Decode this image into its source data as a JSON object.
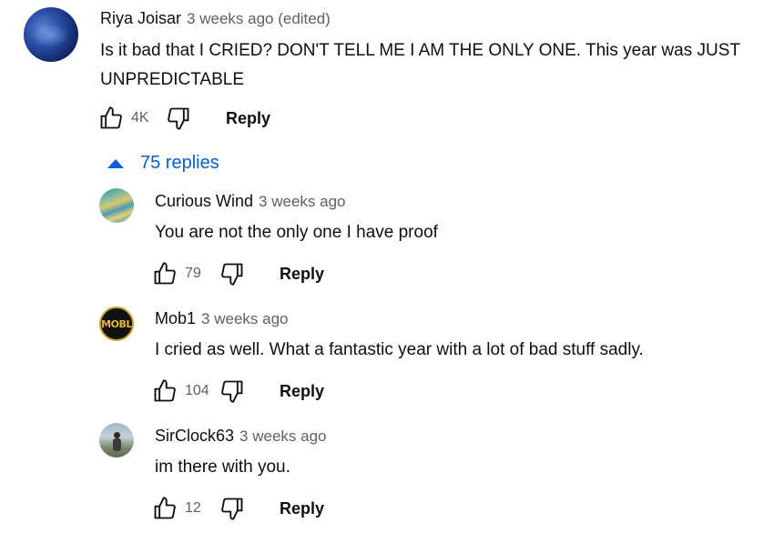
{
  "comment": {
    "author": "Riya Joisar",
    "time": "3 weeks ago (edited)",
    "text": "Is it bad that I CRIED? DON'T TELL ME I AM THE ONLY ONE. This year was JUST UNPREDICTABLE",
    "likes": "4K",
    "reply_label": "Reply"
  },
  "replies_toggle": {
    "label": "75 replies",
    "expanded": true
  },
  "replies": [
    {
      "author": "Curious Wind",
      "time": "3 weeks ago",
      "text": "You are not the only one I have proof",
      "likes": "79",
      "reply_label": "Reply"
    },
    {
      "author": "Mob1",
      "time": "3 weeks ago",
      "text": "I cried as well. What a fantastic year with a lot of bad stuff sadly.",
      "likes": "104",
      "reply_label": "Reply"
    },
    {
      "author": "SirClock63",
      "time": "3 weeks ago",
      "text": "im there with you.",
      "likes": "12",
      "reply_label": "Reply"
    }
  ],
  "avatar_labels": {
    "mob1": "MOBL"
  },
  "colors": {
    "link_blue": "#065fd4",
    "secondary_text": "#606060",
    "primary_text": "#0f0f0f"
  }
}
